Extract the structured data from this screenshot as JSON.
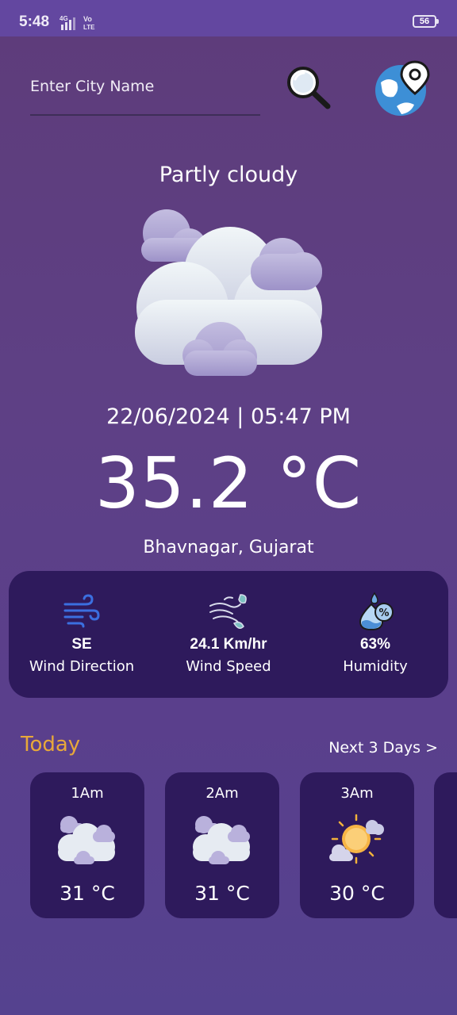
{
  "status_bar": {
    "time": "5:48",
    "network": "4G",
    "volte": "Vo LTE",
    "battery": "56"
  },
  "search": {
    "placeholder": "Enter City Name"
  },
  "current": {
    "condition": "Partly cloudy",
    "datetime": "22/06/2024 | 05:47 PM",
    "temperature": "35.2 °C",
    "location": "Bhavnagar, Gujarat"
  },
  "stats": [
    {
      "value": "SE",
      "label": "Wind Direction",
      "icon": "wind-icon"
    },
    {
      "value": "24.1 Km/hr",
      "label": "Wind Speed",
      "icon": "wind-leaf-icon"
    },
    {
      "value": "63%",
      "label": "Humidity",
      "icon": "humidity-icon"
    }
  ],
  "today": {
    "title": "Today",
    "next_link": "Next 3 Days >",
    "hours": [
      {
        "time": "1Am",
        "temp": "31 °C",
        "icon": "partly-cloudy-icon"
      },
      {
        "time": "2Am",
        "temp": "31 °C",
        "icon": "partly-cloudy-icon"
      },
      {
        "time": "3Am",
        "temp": "30 °C",
        "icon": "sun-cloud-icon"
      }
    ]
  },
  "colors": {
    "card_bg": "#2e1a5c",
    "today_accent": "#e8a83a",
    "status_bar": "#6347a0"
  }
}
